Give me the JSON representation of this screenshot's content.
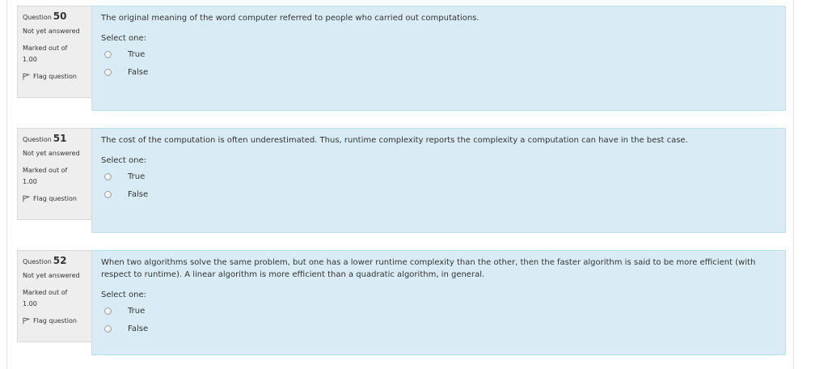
{
  "questions": [
    {
      "label": "Question",
      "number": "50",
      "state": "Not yet answered",
      "grade_label": "Marked out of",
      "grade_value": "1.00",
      "flag_label": "Flag question",
      "text": "The original meaning of the word computer referred to people who carried out computations.",
      "prompt": "Select one:",
      "options": [
        "True",
        "False"
      ]
    },
    {
      "label": "Question",
      "number": "51",
      "state": "Not yet answered",
      "grade_label": "Marked out of",
      "grade_value": "1.00",
      "flag_label": "Flag question",
      "text": "The cost of the computation is often underestimated.  Thus, runtime complexity reports the complexity a computation can have in the best case.",
      "prompt": "Select one:",
      "options": [
        "True",
        "False"
      ]
    },
    {
      "label": "Question",
      "number": "52",
      "state": "Not yet answered",
      "grade_label": "Marked out of",
      "grade_value": "1.00",
      "flag_label": "Flag question",
      "text": "When two algorithms solve the same problem, but one has a lower runtime complexity than the other, then the faster algorithm is said to be more efficient (with respect to runtime).  A linear algorithm is more efficient than a quadratic algorithm, in general.",
      "prompt": "Select one:",
      "options": [
        "True",
        "False"
      ]
    }
  ],
  "colors": {
    "content_bg": "#d9ecf5",
    "content_border": "#bcdfee",
    "info_bg": "#eeeeee"
  },
  "icons": {
    "flag": "flag-icon",
    "radio": "radio-button"
  }
}
